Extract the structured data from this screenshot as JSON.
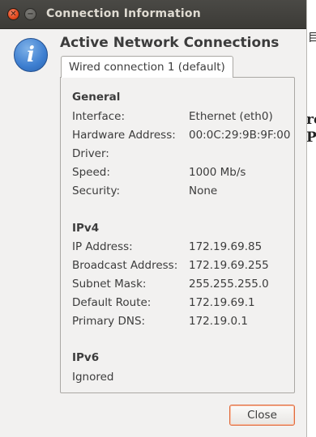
{
  "window": {
    "title": "Connection Information"
  },
  "heading": "Active Network Connections",
  "tab": {
    "label": "Wired connection 1 (default)"
  },
  "sections": {
    "general": {
      "title": "General",
      "rows": [
        {
          "label": "Interface:",
          "value": "Ethernet (eth0)"
        },
        {
          "label": "Hardware Address:",
          "value": "00:0C:29:9B:9F:00"
        },
        {
          "label": "Driver:",
          "value": ""
        },
        {
          "label": "Speed:",
          "value": "1000 Mb/s"
        },
        {
          "label": "Security:",
          "value": "None"
        }
      ]
    },
    "ipv4": {
      "title": "IPv4",
      "rows": [
        {
          "label": "IP Address:",
          "value": "172.19.69.85"
        },
        {
          "label": "Broadcast Address:",
          "value": "172.19.69.255"
        },
        {
          "label": "Subnet Mask:",
          "value": "255.255.255.0"
        },
        {
          "label": "Default Route:",
          "value": "172.19.69.1"
        },
        {
          "label": "Primary DNS:",
          "value": "172.19.0.1"
        }
      ]
    },
    "ipv6": {
      "title": "IPv6",
      "status": "Ignored"
    }
  },
  "buttons": {
    "close_label": "Close"
  },
  "icons": {
    "info": "info-icon",
    "close": "close-icon",
    "minimize": "minimize-icon"
  },
  "colors": {
    "titlebar": "#3c3b37",
    "close_button_accent": "#e2491d",
    "info_icon": "#3d7ed0"
  }
}
